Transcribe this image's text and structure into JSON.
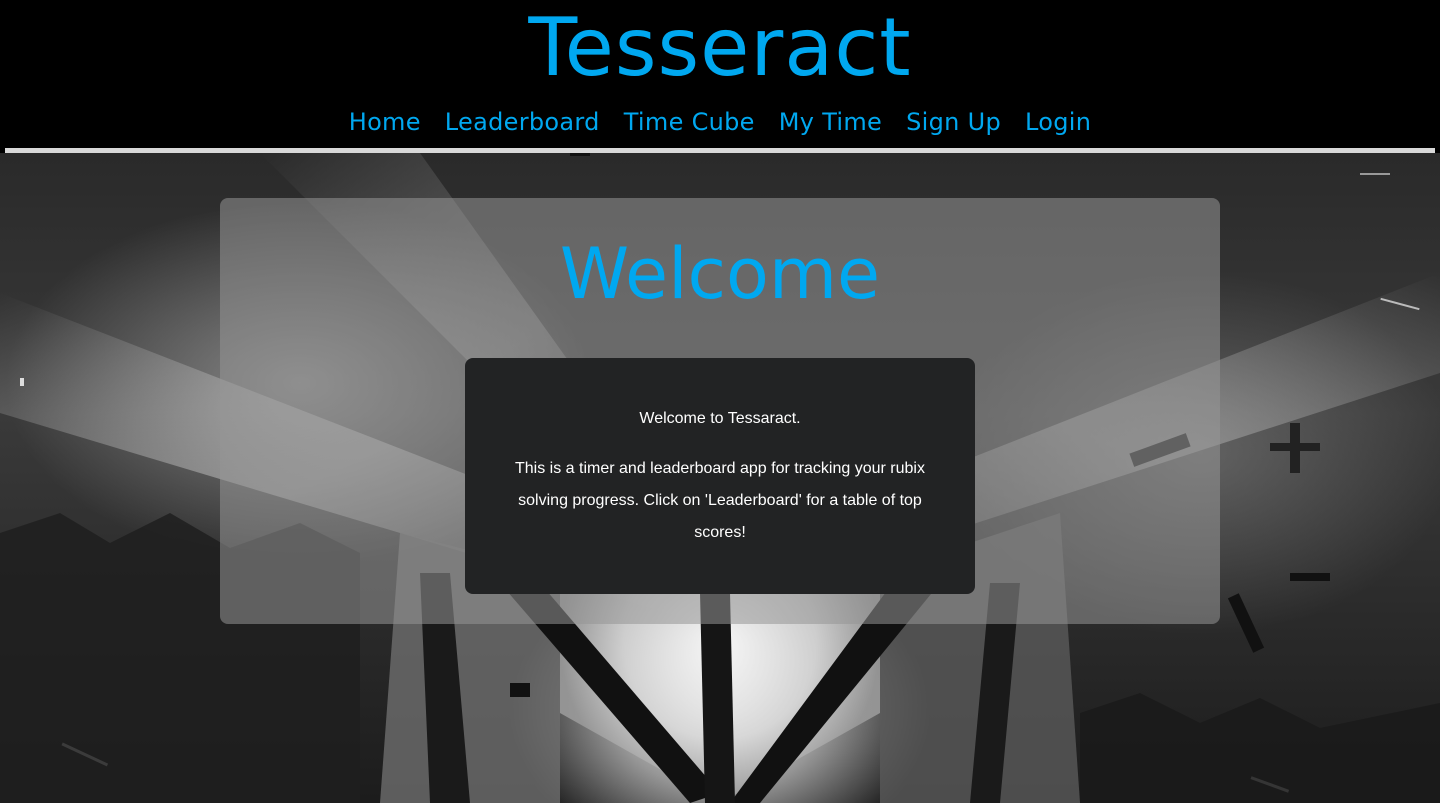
{
  "header": {
    "title": "Tesseract",
    "nav": [
      {
        "label": "Home"
      },
      {
        "label": "Leaderboard"
      },
      {
        "label": "Time Cube"
      },
      {
        "label": "My Time"
      },
      {
        "label": "Sign Up"
      },
      {
        "label": "Login"
      }
    ]
  },
  "main": {
    "heading": "Welcome",
    "intro": "Welcome to Tessaract.",
    "body": "This is a timer and leaderboard app for tracking your rubix solving progress. Click on 'Leaderboard' for a table of top scores!"
  },
  "colors": {
    "accent": "#00a8f0",
    "header_background": "#000000",
    "card_background": "#222324",
    "rule": "#d9d9d9"
  }
}
